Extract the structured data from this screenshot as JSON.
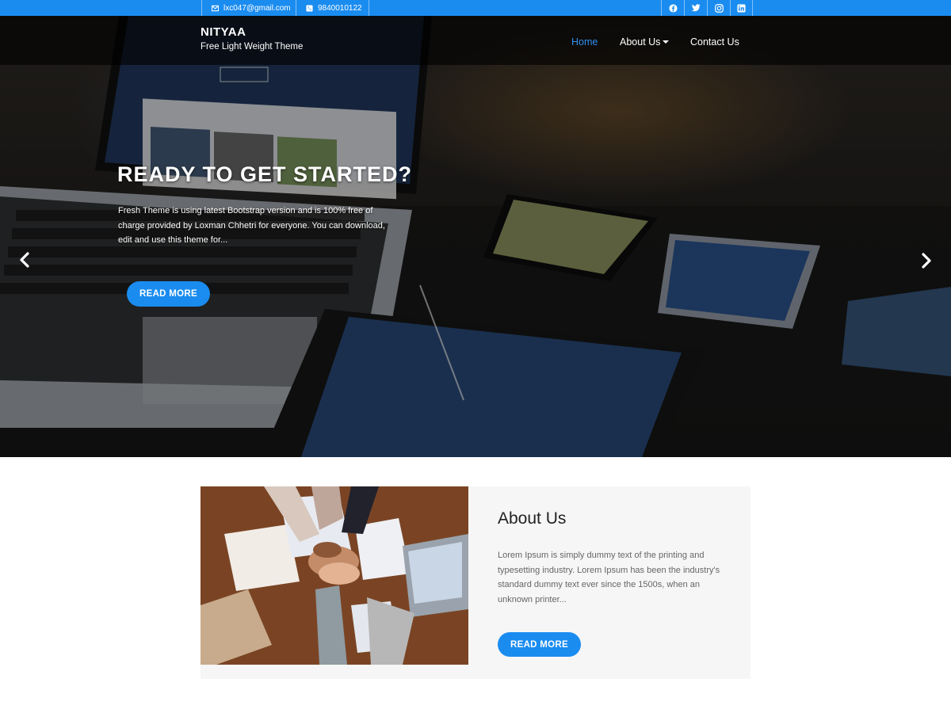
{
  "topbar": {
    "email": "lxc047@gmail.com",
    "phone": "9840010122",
    "socials": [
      "facebook-icon",
      "twitter-icon",
      "instagram-icon",
      "linkedin-icon"
    ]
  },
  "brand": {
    "title": "NITYAA",
    "subtitle": "Free Light Weight Theme"
  },
  "nav": {
    "items": [
      {
        "label": "Home",
        "active": true
      },
      {
        "label": "About Us",
        "dropdown": true
      },
      {
        "label": "Contact Us"
      }
    ]
  },
  "hero": {
    "title": "READY TO GET STARTED?",
    "text": "Fresh Theme is using latest Bootstrap version and is 100% free of charge provided by Loxman Chhetri for everyone. You can download, edit and use this theme for...",
    "button": "READ MORE",
    "prev_icon": "chevron-left-icon",
    "next_icon": "chevron-right-icon"
  },
  "about": {
    "title": "About Us",
    "text": "Lorem Ipsum is simply dummy text of the printing and typesetting industry. Lorem Ipsum has been the industry's standard dummy text ever since the 1500s, when an unknown printer...",
    "button": "READ MORE"
  },
  "colors": {
    "accent": "#1a8cf0",
    "nav_active": "#2f8ff0",
    "section_bg": "#f6f6f6"
  }
}
